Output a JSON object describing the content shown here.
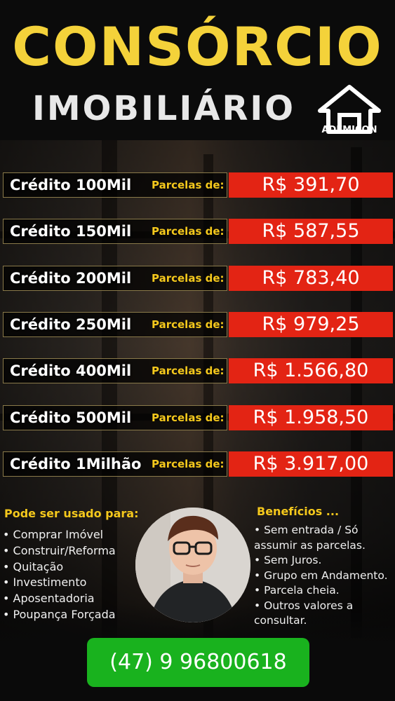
{
  "header": {
    "title": "CONSÓRCIO",
    "subtitle": "IMOBILIÁRIO",
    "brand": "ADEMICON"
  },
  "plans": [
    {
      "credit": "Crédito 100Mil",
      "installment_label": "Parcelas de:",
      "value": "R$ 391,70"
    },
    {
      "credit": "Crédito 150Mil",
      "installment_label": "Parcelas de:",
      "value": "R$ 587,55"
    },
    {
      "credit": "Crédito 200Mil",
      "installment_label": "Parcelas de:",
      "value": "R$ 783,40"
    },
    {
      "credit": "Crédito 250Mil",
      "installment_label": "Parcelas de:",
      "value": "R$ 979,25"
    },
    {
      "credit": "Crédito 400Mil",
      "installment_label": "Parcelas de:",
      "value": "R$ 1.566,80"
    },
    {
      "credit": "Crédito 500Mil",
      "installment_label": "Parcelas de:",
      "value": "R$ 1.958,50"
    },
    {
      "credit": "Crédito 1Milhão",
      "installment_label": "Parcelas de:",
      "value": "R$ 3.917,00"
    }
  ],
  "uses": {
    "title": "Pode ser usado para:",
    "items": [
      "• Comprar Imóvel",
      "• Construir/Reforma",
      "• Quitação",
      "• Investimento",
      "• Aposentadoria",
      "• Poupança Forçada"
    ]
  },
  "benefits": {
    "title": "Benefícios ...",
    "items": [
      "• Sem entrada / Só assumir as parcelas.",
      "• Sem Juros.",
      "• Grupo em Andamento.",
      "• Parcela cheia.",
      "• Outros valores a consultar."
    ]
  },
  "contact": {
    "phone": "(47) 9 96800618"
  },
  "colors": {
    "title_yellow": "#f4d23a",
    "label_yellow": "#f4c81c",
    "value_red": "#e32414",
    "phone_green": "#19b21e"
  },
  "icons": [
    "ademicon-logo-icon",
    "person-photo"
  ]
}
